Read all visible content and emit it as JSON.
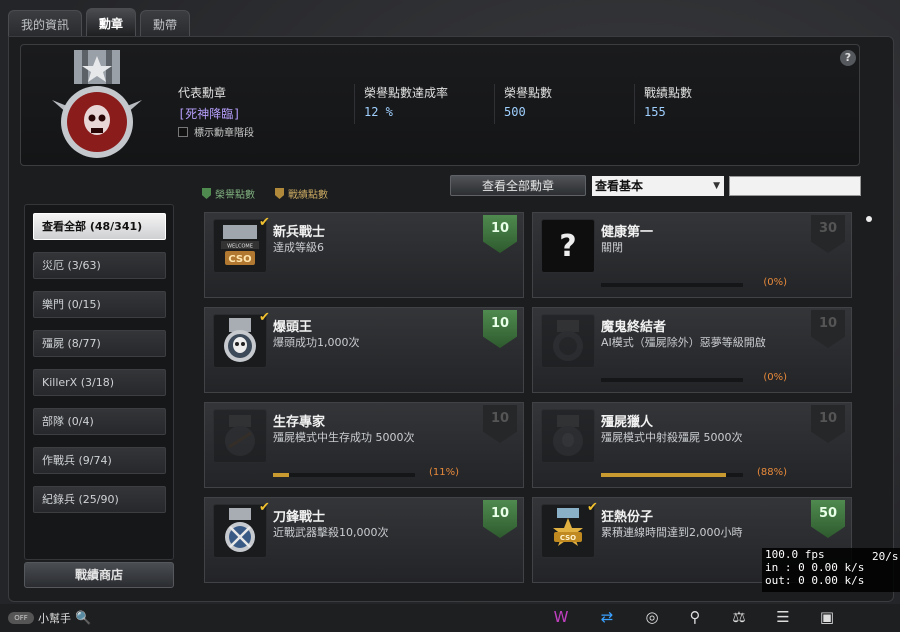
{
  "tabs": [
    "我的資訊",
    "勳章",
    "勳帶"
  ],
  "header": {
    "rep_label": "代表勳章",
    "rep_value": "[死神降臨]",
    "rate_label": "榮譽點數達成率",
    "rate_value": "12 %",
    "honor_label": "榮譽點數",
    "honor_value": "500",
    "battle_label": "戰績點數",
    "battle_value": "155",
    "show_stage": "標示勳章階段",
    "help": "?"
  },
  "legend": {
    "honor": "榮譽點數",
    "battle": "戰績點數"
  },
  "toolbar": {
    "view_all": "查看全部勳章",
    "select_value": "查看基本",
    "search_value": ""
  },
  "sidebar": {
    "items": [
      "查看全部 (48/341)",
      "災厄 (3/63)",
      "樂門 (0/15)",
      "殭屍 (8/77)",
      "KillerX (3/18)",
      "部隊 (0/4)",
      "作戰兵 (9/74)",
      "紀錄兵 (25/90)"
    ],
    "shop": "戰績商店"
  },
  "cards": [
    {
      "title": "新兵戰士",
      "desc": "達成等級6",
      "points": "10",
      "earned": true,
      "icon": "welcome-cso-icon"
    },
    {
      "title": "健康第一",
      "desc": "關閉",
      "points": "30",
      "earned": false,
      "progress": 0,
      "pct": "(0%)",
      "icon": "question-icon"
    },
    {
      "title": "爆頭王",
      "desc": "爆頭成功1,000次",
      "points": "10",
      "earned": true,
      "icon": "skull-medal-icon"
    },
    {
      "title": "魔鬼終結者",
      "desc": "AI模式（殭屍除外）惡夢等級開啟",
      "points": "10",
      "earned": false,
      "progress": 0,
      "pct": "(0%)",
      "icon": "demon-medal-icon"
    },
    {
      "title": "生存專家",
      "desc": "殭屍模式中生存成功 5000次",
      "points": "10",
      "earned": false,
      "progress": 0.11,
      "pct": "(11%)",
      "icon": "survival-medal-icon"
    },
    {
      "title": "殭屍獵人",
      "desc": "殭屍模式中射殺殭屍 5000次",
      "points": "10",
      "earned": false,
      "progress": 0.88,
      "pct": "(88%)",
      "icon": "zombie-hunter-icon"
    },
    {
      "title": "刀鋒戰士",
      "desc": "近戰武器擊殺10,000次",
      "points": "10",
      "earned": true,
      "icon": "blade-medal-icon"
    },
    {
      "title": "狂熱份子",
      "desc": "累積連線時間達到2,000小時",
      "points": "50",
      "earned": true,
      "icon": "cso-star-icon"
    }
  ],
  "bottom": {
    "toggle": "OFF",
    "helper": "小幫手"
  },
  "fps": {
    "line1": "100.0 fps",
    "line1r": "20/s",
    "line2": "in :  0 0.00 k/s",
    "line3": "out:  0 0.00 k/s"
  },
  "colors": {
    "earned": "#4f8a4f",
    "progress": "#c89a30",
    "pct": "#e88a3a",
    "rep": "#b8a0ff"
  }
}
